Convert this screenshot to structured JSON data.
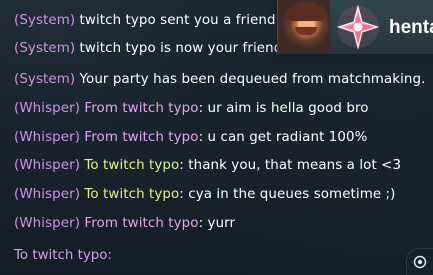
{
  "chat": {
    "messages": [
      {
        "prefix": "(System)",
        "target": "",
        "text": " twitch typo sent you a friend request."
      },
      {
        "prefix": "(System)",
        "target": "",
        "text": " twitch typo is now your friend."
      },
      {
        "prefix": "(System)",
        "target": "",
        "text": " Your party has been dequeued from matchmaking."
      },
      {
        "prefix": "(Whisper)",
        "target": "From twitch typo",
        "text": ": ur aim is hella good bro"
      },
      {
        "prefix": "(Whisper)",
        "target": "From twitch typo",
        "text": ": u can get radiant 100%"
      },
      {
        "prefix": "(Whisper)",
        "target": "To twitch typo",
        "text": ": thank you, that means a lot <3"
      },
      {
        "prefix": "(Whisper)",
        "target": "To twitch typo",
        "text": ": cya in the queues sometime ;)"
      },
      {
        "prefix": "(Whisper)",
        "target": "From twitch typo",
        "text": ": yurr"
      }
    ],
    "input_prefix": "To twitch typo:"
  },
  "friend_card": {
    "name": "henta"
  },
  "colors": {
    "system_prefix": "#d391e8",
    "from_target": "#e6a3ef",
    "to_target": "#e8f07e",
    "message_text": "#ffffff",
    "input_text": "#d59ff0"
  },
  "icons": {
    "avatar": "player-avatar",
    "rank": "radiant-rank-icon",
    "corner": "chat-settings-icon"
  }
}
